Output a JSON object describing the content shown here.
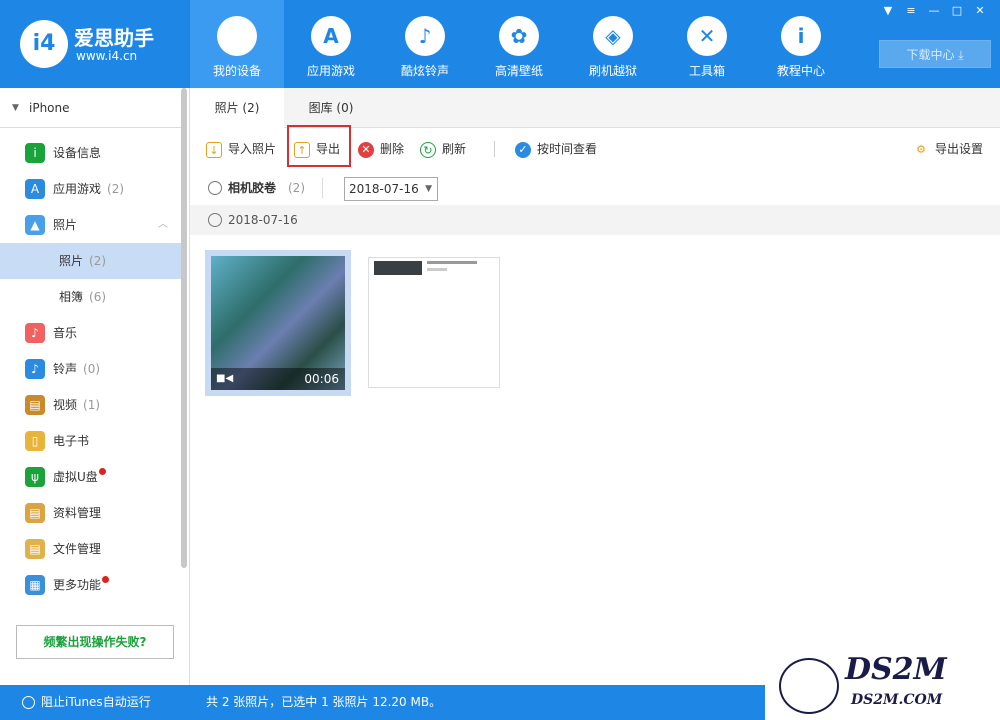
{
  "app": {
    "logo_mark": "i4",
    "name": "爱思助手",
    "url": "www.i4.cn"
  },
  "nav": [
    {
      "label": "我的设备",
      "icon": "apple-icon",
      "glyph": "",
      "active": true
    },
    {
      "label": "应用游戏",
      "icon": "app-store-icon",
      "glyph": "A"
    },
    {
      "label": "酷炫铃声",
      "icon": "bell-icon",
      "glyph": "♪"
    },
    {
      "label": "高清壁纸",
      "icon": "flower-icon",
      "glyph": "✿"
    },
    {
      "label": "刷机越狱",
      "icon": "dropbox-icon",
      "glyph": "◈"
    },
    {
      "label": "工具箱",
      "icon": "tools-icon",
      "glyph": "✕"
    },
    {
      "label": "教程中心",
      "icon": "info-icon",
      "glyph": "i"
    }
  ],
  "window_controls": [
    {
      "name": "skin-icon",
      "glyph": "▼"
    },
    {
      "name": "menu-icon",
      "glyph": "≡"
    },
    {
      "name": "minimize-icon",
      "glyph": "—"
    },
    {
      "name": "maximize-icon",
      "glyph": "□"
    },
    {
      "name": "close-icon",
      "glyph": "✕"
    }
  ],
  "download_center": "下载中心 ⤓",
  "sidebar": {
    "device": "iPhone",
    "items": [
      {
        "label": "设备信息",
        "count": "",
        "icon": "info-icon",
        "color": "#1aa23b",
        "glyph": "i"
      },
      {
        "label": "应用游戏",
        "count": "(2)",
        "icon": "app-store-icon",
        "color": "#2a8be0",
        "glyph": "A"
      },
      {
        "label": "照片",
        "count": "",
        "icon": "photo-icon",
        "color": "#4aa0e8",
        "glyph": "▲",
        "collapse": "︿"
      },
      {
        "label": "照片",
        "count": "(2)",
        "sub": true,
        "active": true
      },
      {
        "label": "相簿",
        "count": "(6)",
        "sub": true
      },
      {
        "label": "音乐",
        "count": "",
        "icon": "music-icon",
        "color": "#f06262",
        "glyph": "♪"
      },
      {
        "label": "铃声",
        "count": "(0)",
        "icon": "bell-icon",
        "color": "#2a8be0",
        "glyph": "♪"
      },
      {
        "label": "视频",
        "count": "(1)",
        "icon": "video-icon",
        "color": "#c88a2a",
        "glyph": "▤"
      },
      {
        "label": "电子书",
        "count": "",
        "icon": "book-icon",
        "color": "#e8b43a",
        "glyph": "▯"
      },
      {
        "label": "虚拟U盘",
        "count": "",
        "icon": "usb-icon",
        "color": "#1aa23b",
        "glyph": "ψ",
        "dot": true
      },
      {
        "label": "资料管理",
        "count": "",
        "icon": "contacts-icon",
        "color": "#d9a441",
        "glyph": "▤"
      },
      {
        "label": "文件管理",
        "count": "",
        "icon": "file-icon",
        "color": "#e0b24c",
        "glyph": "▤"
      },
      {
        "label": "更多功能",
        "count": "",
        "icon": "grid-icon",
        "color": "#3a8fd8",
        "glyph": "▦",
        "dot": true
      }
    ],
    "fail_button": "频繁出现操作失败?"
  },
  "tabs": [
    {
      "label": "照片 (2)",
      "active": true
    },
    {
      "label": "图库 (0)"
    }
  ],
  "toolbar": {
    "import": "导入照片",
    "export": "导出",
    "delete": "删除",
    "refresh": "刷新",
    "by_time": "按时间查看",
    "export_settings": "导出设置"
  },
  "filter": {
    "album": "相机胶卷",
    "count": "(2)",
    "date": "2018-07-16"
  },
  "group_date": "2018-07-16",
  "thumbnails": [
    {
      "type": "video",
      "duration": "00:06",
      "selected": true
    },
    {
      "type": "image",
      "selected": false
    }
  ],
  "statusbar": {
    "itunes": "阻止iTunes自动运行",
    "summary": "共 2 张照片，已选中 1 张照片 12.20 MB。"
  },
  "watermark": {
    "name": "DS2M",
    "url": "DS2M.COM"
  }
}
